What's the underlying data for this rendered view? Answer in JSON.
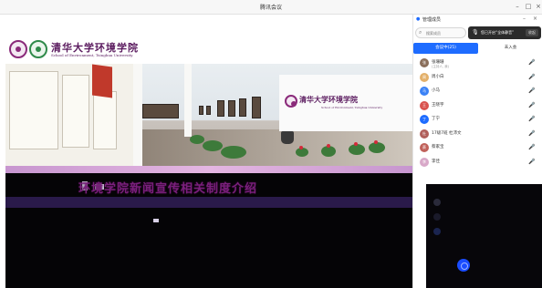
{
  "window": {
    "title": "腾讯会议",
    "controls": [
      "–",
      "□",
      "×"
    ]
  },
  "shared_slide": {
    "logo_text": "清华大学环境学院",
    "logo_subtitle": "School of Environment, Tsinghua University",
    "photo_sign": "清华大学环境学院",
    "photo_sign_en": "School of Environment, Tsinghua University",
    "heading": "环境学院新闻宣传相关制度介绍"
  },
  "panel": {
    "title": "管理成员",
    "search_placeholder": "搜索成员",
    "toast_text": "您已开启“全体静音”",
    "toast_button": "收起",
    "tabs": [
      {
        "label": "会议中(25)"
      },
      {
        "label": "未入会"
      }
    ],
    "participants": [
      {
        "name": "张珊珊",
        "sub": "(主持人, 我)",
        "initial": "张",
        "color": "#8a6e5a",
        "host": true
      },
      {
        "name": "周小白",
        "sub": "",
        "initial": "周",
        "color": "#e3b06a",
        "host": false
      },
      {
        "name": "小马",
        "sub": "",
        "initial": "马",
        "color": "#3b82f6",
        "host": false
      },
      {
        "name": "王晓宇",
        "sub": "",
        "initial": "王",
        "color": "#d9534f",
        "host": false
      },
      {
        "name": "丁宁",
        "sub": "",
        "initial": "丁",
        "color": "#1e6cff",
        "host": false
      },
      {
        "name": "17级7班 杜沛文",
        "sub": "",
        "initial": "杜",
        "color": "#b05f5a",
        "host": false
      },
      {
        "name": "蔡家宝",
        "sub": "",
        "initial": "蔡",
        "color": "#c0615a",
        "host": false
      },
      {
        "name": "李佳",
        "sub": "",
        "initial": "李",
        "color": "#d8a8c8",
        "host": false
      }
    ],
    "host_mic_icon": "mic-on-icon",
    "member_mic_icon": "mic-muted-icon"
  }
}
